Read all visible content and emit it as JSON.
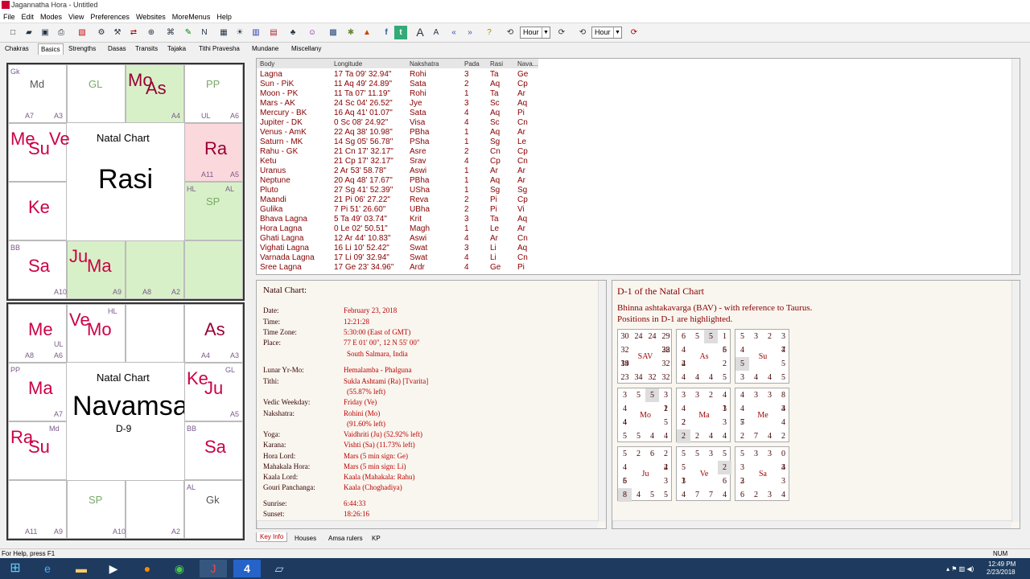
{
  "window": {
    "title": "Jagannatha Hora - Untitled"
  },
  "menu": [
    "File",
    "Edit",
    "Modes",
    "View",
    "Preferences",
    "Websites",
    "MoreMenus",
    "Help"
  ],
  "toolbar": {
    "select1": "Hour",
    "select2": "Hour"
  },
  "tabs": [
    "Chakras",
    "Basics",
    "Strengths",
    "Dasas",
    "Transits",
    "Tajaka",
    "Tithi Pravesha",
    "Mundane",
    "Miscellany"
  ],
  "active_tab": "Basics",
  "rasi": {
    "title": "Natal Chart",
    "name": "Rasi",
    "cells": [
      {
        "x": 0,
        "y": 0,
        "fill": "#fff",
        "planets": [
          {
            "t": "Md",
            "x": 26,
            "y": 16,
            "c": "#555",
            "s": 13
          }
        ],
        "small": [
          {
            "t": "Gk",
            "x": 2,
            "y": 3
          },
          {
            "t": "A7",
            "x": 20,
            "y": 58
          },
          {
            "t": "A3",
            "x": 56,
            "y": 58
          }
        ]
      },
      {
        "x": 1,
        "y": 0,
        "fill": "#fff",
        "planets": [
          {
            "t": "GL",
            "x": 26,
            "y": 16,
            "c": "#7a6",
            "s": 13
          }
        ],
        "small": []
      },
      {
        "x": 2,
        "y": 0,
        "fill": "#d8f0c8",
        "planets": [
          {
            "t": "Mo",
            "x": 2,
            "y": 6,
            "c": "#903",
            "s": 22
          },
          {
            "t": "As",
            "x": 24,
            "y": 16,
            "c": "#903",
            "s": 22
          }
        ],
        "small": [
          {
            "t": "A4",
            "x": 56,
            "y": 58
          }
        ]
      },
      {
        "x": 3,
        "y": 0,
        "fill": "#fff",
        "planets": [
          {
            "t": "PP",
            "x": 26,
            "y": 16,
            "c": "#7a6",
            "s": 13
          }
        ],
        "small": [
          {
            "t": "UL",
            "x": 20,
            "y": 58
          },
          {
            "t": "A6",
            "x": 56,
            "y": 58
          }
        ]
      },
      {
        "x": 0,
        "y": 1,
        "fill": "#fff",
        "planets": [
          {
            "t": "Me",
            "x": 2,
            "y": 6,
            "c": "#c04",
            "s": 22
          },
          {
            "t": "Su",
            "x": 24,
            "y": 18,
            "c": "#c04",
            "s": 22
          },
          {
            "t": "Ve",
            "x": 50,
            "y": 6,
            "c": "#c04",
            "s": 22
          }
        ],
        "small": []
      },
      {
        "x": 3,
        "y": 1,
        "fill": "#fbd8dc",
        "planets": [
          {
            "t": "Ra",
            "x": 24,
            "y": 18,
            "c": "#903",
            "s": 22
          }
        ],
        "small": [
          {
            "t": "A11",
            "x": 20,
            "y": 58
          },
          {
            "t": "A5",
            "x": 56,
            "y": 58
          }
        ]
      },
      {
        "x": 0,
        "y": 2,
        "fill": "#fff",
        "planets": [
          {
            "t": "Ke",
            "x": 24,
            "y": 18,
            "c": "#c04",
            "s": 22
          }
        ],
        "small": []
      },
      {
        "x": 3,
        "y": 2,
        "fill": "#d8f0c8",
        "planets": [
          {
            "t": "SP",
            "x": 26,
            "y": 16,
            "c": "#7a6",
            "s": 13
          }
        ],
        "small": [
          {
            "t": "HL",
            "x": 2,
            "y": 3
          },
          {
            "t": "AL",
            "x": 50,
            "y": 3
          }
        ]
      },
      {
        "x": 0,
        "y": 3,
        "fill": "#fff",
        "planets": [
          {
            "t": "Sa",
            "x": 24,
            "y": 18,
            "c": "#c04",
            "s": 22
          }
        ],
        "small": [
          {
            "t": "BB",
            "x": 2,
            "y": 3
          },
          {
            "t": "A10",
            "x": 56,
            "y": 58
          }
        ]
      },
      {
        "x": 1,
        "y": 3,
        "fill": "#d8f0c8",
        "planets": [
          {
            "t": "Ju",
            "x": 2,
            "y": 6,
            "c": "#c04",
            "s": 22
          },
          {
            "t": "Ma",
            "x": 24,
            "y": 18,
            "c": "#c04",
            "s": 22
          }
        ],
        "small": [
          {
            "t": "A9",
            "x": 56,
            "y": 58
          }
        ]
      },
      {
        "x": 2,
        "y": 3,
        "fill": "#d8f0c8",
        "planets": [],
        "small": [
          {
            "t": "A8",
            "x": 20,
            "y": 58
          },
          {
            "t": "A2",
            "x": 56,
            "y": 58
          }
        ]
      },
      {
        "x": 3,
        "y": 3,
        "fill": "#d8f0c8",
        "planets": [],
        "small": []
      }
    ]
  },
  "navamsa": {
    "title": "Natal Chart",
    "name": "Navamsa",
    "sub": "D-9",
    "cells": [
      {
        "x": 0,
        "y": 0,
        "fill": "#fff",
        "planets": [
          {
            "t": "Me",
            "x": 24,
            "y": 18,
            "c": "#c04",
            "s": 22
          }
        ],
        "small": [
          {
            "t": "UL",
            "x": 56,
            "y": 44
          },
          {
            "t": "A8",
            "x": 20,
            "y": 58
          },
          {
            "t": "A6",
            "x": 56,
            "y": 58
          }
        ]
      },
      {
        "x": 1,
        "y": 0,
        "fill": "#fff",
        "planets": [
          {
            "t": "Ve",
            "x": 2,
            "y": 6,
            "c": "#c04",
            "s": 22
          },
          {
            "t": "Mo",
            "x": 24,
            "y": 18,
            "c": "#c04",
            "s": 22
          }
        ],
        "small": [
          {
            "t": "HL",
            "x": 50,
            "y": 3
          }
        ]
      },
      {
        "x": 2,
        "y": 0,
        "fill": "#fff",
        "planets": [],
        "small": []
      },
      {
        "x": 3,
        "y": 0,
        "fill": "#fff",
        "planets": [
          {
            "t": "As",
            "x": 24,
            "y": 18,
            "c": "#903",
            "s": 22
          }
        ],
        "small": [
          {
            "t": "A4",
            "x": 20,
            "y": 58
          },
          {
            "t": "A3",
            "x": 56,
            "y": 58
          }
        ]
      },
      {
        "x": 0,
        "y": 1,
        "fill": "#fff",
        "planets": [
          {
            "t": "Ma",
            "x": 24,
            "y": 18,
            "c": "#c04",
            "s": 22
          }
        ],
        "small": [
          {
            "t": "PP",
            "x": 2,
            "y": 3
          },
          {
            "t": "A7",
            "x": 56,
            "y": 58
          }
        ]
      },
      {
        "x": 3,
        "y": 1,
        "fill": "#fff",
        "planets": [
          {
            "t": "Ke",
            "x": 2,
            "y": 6,
            "c": "#c04",
            "s": 22
          },
          {
            "t": "Ju",
            "x": 24,
            "y": 18,
            "c": "#c04",
            "s": 22
          }
        ],
        "small": [
          {
            "t": "GL",
            "x": 50,
            "y": 3
          },
          {
            "t": "A5",
            "x": 56,
            "y": 58
          }
        ]
      },
      {
        "x": 0,
        "y": 2,
        "fill": "#fff",
        "planets": [
          {
            "t": "Ra",
            "x": 2,
            "y": 6,
            "c": "#c04",
            "s": 22
          },
          {
            "t": "Su",
            "x": 24,
            "y": 18,
            "c": "#c04",
            "s": 22
          }
        ],
        "small": [
          {
            "t": "Md",
            "x": 50,
            "y": 3
          }
        ]
      },
      {
        "x": 3,
        "y": 2,
        "fill": "#fff",
        "planets": [
          {
            "t": "Sa",
            "x": 24,
            "y": 18,
            "c": "#c04",
            "s": 22
          }
        ],
        "small": [
          {
            "t": "BB",
            "x": 2,
            "y": 3
          }
        ]
      },
      {
        "x": 0,
        "y": 3,
        "fill": "#fff",
        "planets": [],
        "small": [
          {
            "t": "A11",
            "x": 20,
            "y": 58
          },
          {
            "t": "A9",
            "x": 56,
            "y": 58
          }
        ]
      },
      {
        "x": 1,
        "y": 3,
        "fill": "#fff",
        "planets": [
          {
            "t": "SP",
            "x": 26,
            "y": 16,
            "c": "#7a6",
            "s": 13
          }
        ],
        "small": [
          {
            "t": "A10",
            "x": 56,
            "y": 58
          }
        ]
      },
      {
        "x": 2,
        "y": 3,
        "fill": "#fff",
        "planets": [],
        "small": [
          {
            "t": "A2",
            "x": 56,
            "y": 58
          }
        ]
      },
      {
        "x": 3,
        "y": 3,
        "fill": "#fff",
        "planets": [
          {
            "t": "Gk",
            "x": 26,
            "y": 16,
            "c": "#555",
            "s": 13
          }
        ],
        "small": [
          {
            "t": "AL",
            "x": 2,
            "y": 3
          }
        ]
      }
    ]
  },
  "positions": {
    "headers": [
      "Body",
      "Longitude",
      "Nakshatra",
      "Pada",
      "Rasi",
      "Nava..."
    ],
    "rows": [
      [
        "Lagna",
        "17 Ta 09' 32.94\"",
        "Rohi",
        "3",
        "Ta",
        "Ge"
      ],
      [
        "Sun - PiK",
        "11 Aq 49' 24.89\"",
        "Sata",
        "2",
        "Aq",
        "Cp"
      ],
      [
        "Moon - PK",
        "11 Ta 07' 11.19\"",
        "Rohi",
        "1",
        "Ta",
        "Ar"
      ],
      [
        "Mars - AK",
        "24 Sc 04' 26.52\"",
        "Jye",
        "3",
        "Sc",
        "Aq"
      ],
      [
        "Mercury - BK",
        "16 Aq 41' 01.07\"",
        "Sata",
        "4",
        "Aq",
        "Pi"
      ],
      [
        "Jupiter - DK",
        "0 Sc 08' 24.92\"",
        "Visa",
        "4",
        "Sc",
        "Cn"
      ],
      [
        "Venus - AmK",
        "22 Aq 38' 10.98\"",
        "PBha",
        "1",
        "Aq",
        "Ar"
      ],
      [
        "Saturn - MK",
        "14 Sg 05' 56.78\"",
        "PSha",
        "1",
        "Sg",
        "Le"
      ],
      [
        "Rahu - GK",
        "21 Cn 17' 32.17\"",
        "Asre",
        "2",
        "Cn",
        "Cp"
      ],
      [
        "Ketu",
        "21 Cp 17' 32.17\"",
        "Srav",
        "4",
        "Cp",
        "Cn"
      ],
      [
        "Uranus",
        "2 Ar 53' 58.78\"",
        "Aswi",
        "1",
        "Ar",
        "Ar"
      ],
      [
        "Neptune",
        "20 Aq 48' 17.67\"",
        "PBha",
        "1",
        "Aq",
        "Ar"
      ],
      [
        "Pluto",
        "27 Sg 41' 52.39\"",
        "USha",
        "1",
        "Sg",
        "Sg"
      ],
      [
        "Maandi",
        "21 Pi 06' 27.22\"",
        "Reva",
        "2",
        "Pi",
        "Cp"
      ],
      [
        "Gulika",
        "7 Pi 51' 26.60\"",
        "UBha",
        "2",
        "Pi",
        "Vi"
      ],
      [
        "Bhava Lagna",
        "5 Ta 49' 03.74\"",
        "Krit",
        "3",
        "Ta",
        "Aq"
      ],
      [
        "Hora Lagna",
        "0 Le 02' 50.51\"",
        "Magh",
        "1",
        "Le",
        "Ar"
      ],
      [
        "Ghati Lagna",
        "12 Ar 44' 10.83\"",
        "Aswi",
        "4",
        "Ar",
        "Cn"
      ],
      [
        "Vighati Lagna",
        "16 Li 10' 52.42\"",
        "Swat",
        "3",
        "Li",
        "Aq"
      ],
      [
        "Varnada Lagna",
        "17 Li 09' 32.94\"",
        "Swat",
        "4",
        "Li",
        "Cn"
      ],
      [
        "Sree Lagna",
        "17 Ge 23' 34.96\"",
        "Ardr",
        "4",
        "Ge",
        "Pi"
      ]
    ]
  },
  "info": {
    "heading": "Natal Chart:",
    "rows": [
      [
        "Date:",
        "February 23, 2018"
      ],
      [
        "Time:",
        "12:21:28"
      ],
      [
        "Time Zone:",
        "5:30:00 (East of GMT)"
      ],
      [
        "Place:",
        "77 E 01' 00\", 12 N 55' 00\""
      ],
      [
        "",
        "South Salmara, India"
      ],
      [
        "Lunar Yr-Mo:",
        "Hemalamba - Phalguna"
      ],
      [
        "Tithi:",
        "Sukla Ashtami (Ra) [Tvarita]"
      ],
      [
        "",
        "(55.87% left)"
      ],
      [
        "Vedic Weekday:",
        "Friday (Ve)"
      ],
      [
        "Nakshatra:",
        "Rohini (Mo)"
      ],
      [
        "",
        "(91.60% left)"
      ],
      [
        "Yoga:",
        "Vaidhriti (Ju) (52.92% left)"
      ],
      [
        "Karana:",
        "Vishti (Sa) (11.73% left)"
      ],
      [
        "Hora Lord:",
        "Mars (5 min sign: Ge)"
      ],
      [
        "Mahakala Hora:",
        "Mars (5 min sign: Li)"
      ],
      [
        "Kaala Lord:",
        "Kaala (Mahakala: Rahu)"
      ],
      [
        "Gouri Panchanga:",
        "Kaala (Choghadiya)"
      ],
      [
        "Sunrise:",
        "6:44:33"
      ],
      [
        "Sunset:",
        "18:26:16"
      ]
    ]
  },
  "bav": {
    "title": "D-1 of the Natal Chart",
    "line1": "Bhinna ashtakavarga (BAV) - with reference to Taurus.",
    "line2": "Positions in D-1 are highlighted.",
    "grids": [
      {
        "name": "SAV",
        "n": [
          "30",
          "24",
          "24",
          "29",
          "32",
          "32",
          "32",
          "32",
          "34",
          "23",
          "34",
          "32",
          "28",
          "19"
        ],
        "hl": []
      },
      {
        "name": "As",
        "n": [
          "6",
          "5",
          "5",
          "1",
          "5",
          "2",
          "5",
          "4",
          "4",
          "4",
          "4",
          "4",
          "6",
          "2"
        ],
        "hl": [
          2
        ]
      },
      {
        "name": "Su",
        "n": [
          "5",
          "3",
          "2",
          "3",
          "7",
          "5",
          "5",
          "4",
          "4",
          "3",
          "5",
          "4",
          "4",
          "5"
        ],
        "hl": [
          13
        ]
      },
      {
        "name": "Mo",
        "n": [
          "3",
          "5",
          "5",
          "3",
          "1",
          "5",
          "4",
          "4",
          "5",
          "5",
          "4",
          "4",
          "2",
          "4"
        ],
        "hl": [
          2
        ]
      },
      {
        "name": "Ma",
        "n": [
          "3",
          "3",
          "2",
          "4",
          "3",
          "3",
          "4",
          "4",
          "2",
          "2",
          "2",
          "4",
          "1",
          "2"
        ],
        "hl": [
          9
        ]
      },
      {
        "name": "Me",
        "n": [
          "4",
          "3",
          "3",
          "8",
          "4",
          "4",
          "2",
          "4",
          "7",
          "2",
          "7",
          "4",
          "3",
          "5"
        ],
        "hl": []
      },
      {
        "name": "Ju",
        "n": [
          "5",
          "2",
          "6",
          "2",
          "2",
          "3",
          "5",
          "5",
          "4",
          "8",
          "5",
          "4",
          "4",
          "6"
        ],
        "hl": [
          9
        ]
      },
      {
        "name": "Ve",
        "n": [
          "5",
          "5",
          "3",
          "5",
          "3",
          "6",
          "4",
          "7",
          "7",
          "4",
          "1",
          "5",
          "2",
          "3"
        ],
        "hl": [
          12
        ]
      },
      {
        "name": "Sa",
        "n": [
          "5",
          "3",
          "3",
          "0",
          "4",
          "3",
          "4",
          "3",
          "2",
          "6",
          "2",
          "3",
          "3",
          "3"
        ],
        "hl": []
      }
    ]
  },
  "bottom_tabs": [
    "Key Info",
    "Houses",
    "Amsa rulers",
    "KP"
  ],
  "status": {
    "left": "For Help, press F1",
    "num": "NUM"
  },
  "clock": {
    "time": "12:49 PM",
    "date": "2/23/2018"
  }
}
